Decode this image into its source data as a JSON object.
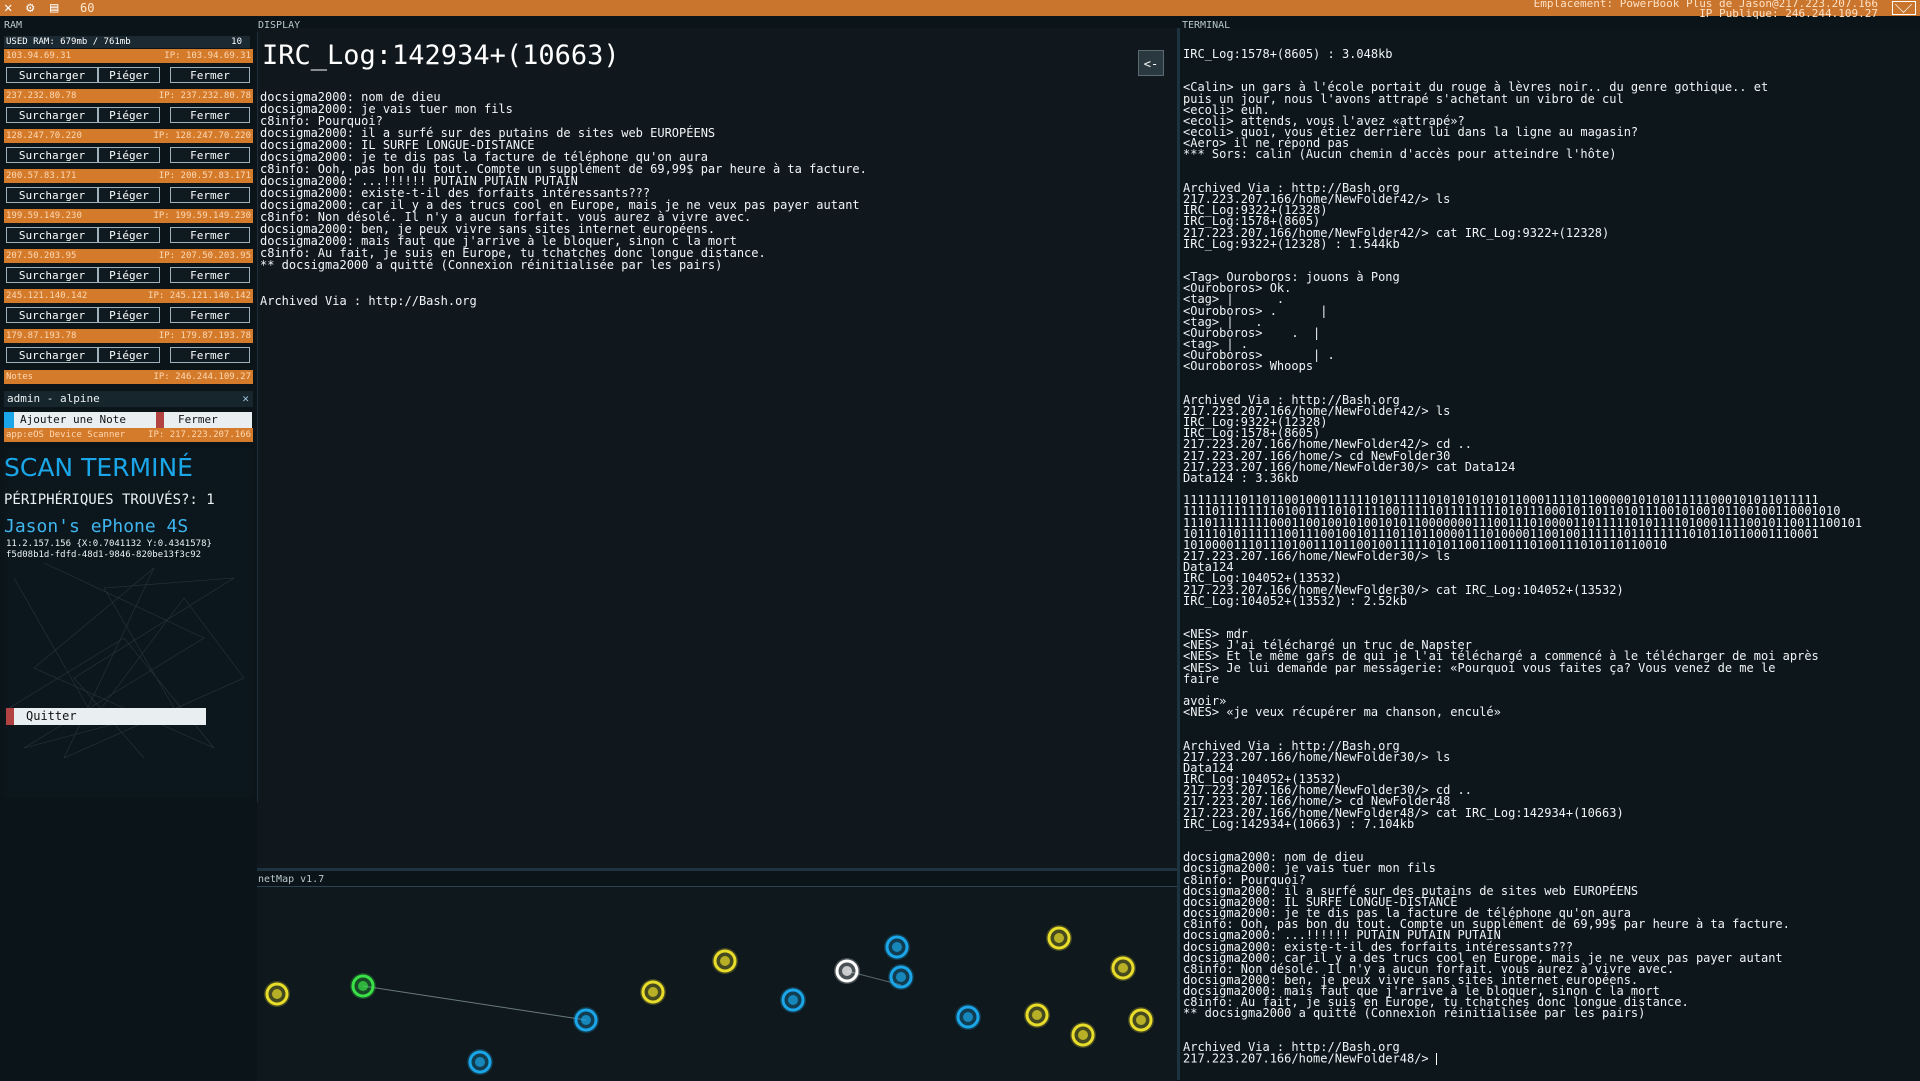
{
  "topbar": {
    "ram_value": "60",
    "location_line1": "Emplacement: PowerBook Plus de Jason@217.223.207.166",
    "location_line2": "IP Publique: 246.244.109.27"
  },
  "labels": {
    "ram": "RAM",
    "display": "DISPLAY",
    "terminal": "TERMINAL",
    "netmap": "netMap v1.7"
  },
  "ram_panel": {
    "used_label": "USED RAM: 679mb / 761mb",
    "used_count": "10",
    "items": [
      {
        "ip": "103.94.69.31",
        "ip_label": "IP: 103.94.69.31"
      },
      {
        "ip": "237.232.80.78",
        "ip_label": "IP: 237.232.80.78"
      },
      {
        "ip": "128.247.70.220",
        "ip_label": "IP: 128.247.70.220"
      },
      {
        "ip": "200.57.83.171",
        "ip_label": "IP: 200.57.83.171"
      },
      {
        "ip": "199.59.149.230",
        "ip_label": "IP: 199.59.149.230"
      },
      {
        "ip": "207.50.203.95",
        "ip_label": "IP: 207.50.203.95"
      },
      {
        "ip": "245.121.140.142",
        "ip_label": "IP: 245.121.140.142"
      },
      {
        "ip": "179.87.193.78",
        "ip_label": "IP: 179.87.193.78"
      }
    ],
    "btn_overload": "Surcharger",
    "btn_trap": "Piéger",
    "btn_close": "Fermer",
    "notes_label": "Notes",
    "notes_ip": "IP: 246.244.109.27",
    "admin_label": "admin - alpine",
    "add_note": "Ajouter une Note",
    "close_note": "Fermer",
    "app_label": "app:eOS Device Scanner",
    "app_ip": "IP: 217.223.207.166"
  },
  "scanner": {
    "title": "SCAN TERMINÉ",
    "found": "PÉRIPHÉRIQUES TROUVÉS?: 1",
    "device": "Jason's ePhone 4S",
    "coords": "11.2.157.156 {X:0.7041132 Y:0.4341578}",
    "uuid": "f5d08b1d-fdfd-48d1-9846-820be13f3c92",
    "quit": "Quitter"
  },
  "display": {
    "title": "IRC_Log:142934+(10663)",
    "back": "<-",
    "body": "docsigma2000: nom de dieu\ndocsigma2000: je vais tuer mon fils\nc8info: Pourquoi?\ndocsigma2000: il a surfé sur des putains de sites web EUROPÉENS\ndocsigma2000: IL SURFE LONGUE-DISTANCE\ndocsigma2000: je te dis pas la facture de téléphone qu'on aura\nc8info: Ooh, pas bon du tout. Compte un supplément de 69,99$ par heure à ta facture.\ndocsigma2000: ...!!!!!! PUTAIN PUTAIN PUTAIN\ndocsigma2000: existe-t-il des forfaits intéressants???\ndocsigma2000: car il y a des trucs cool en Europe, mais je ne veux pas payer autant\nc8info: Non désolé. Il n'y a aucun forfait. vous aurez à vivre avec.\ndocsigma2000: ben, je peux vivre sans sites internet européens.\ndocsigma2000: mais faut que j'arrive à le bloquer, sinon c la mort\nc8info: Au fait, je suis en Europe, tu tchatches donc longue distance.\n** docsigma2000 a quitté (Connexion réinitialisée par les pairs)\n\n\nArchived Via : http://Bash.org"
  },
  "terminal": {
    "body": "IRC_Log:1578+(8605) : 3.048kb\n\n\n<Calin> un gars à l'école portait du rouge à lèvres noir.. du genre gothique.. et\npuis un jour, nous l'avons attrapé s'achetant un vibro de cul\n<ecoli> euh.\n<ecoli> attends, vous l'avez «attrapé»?\n<ecoli> quoi, vous étiez derrière lui dans la ligne au magasin?\n<Aero> il ne répond pas\n*** Sors: calin (Aucun chemin d'accès pour atteindre l'hôte)\n\n\nArchived Via : http://Bash.org\n217.223.207.166/home/NewFolder42/> ls\nIRC_Log:9322+(12328)\nIRC_Log:1578+(8605)\n217.223.207.166/home/NewFolder42/> cat IRC_Log:9322+(12328)\nIRC_Log:9322+(12328) : 1.544kb\n\n\n<Tag> Ouroboros: jouons à Pong\n<Ouroboros> Ok.\n<tag> |      .\n<Ouroboros> .      |\n<tag> |   .\n<Ouroboros>    .  |\n<tag> | .\n<Ouroboros>       | .\n<Ouroboros> Whoops\n\n\nArchived Via : http://Bash.org\n217.223.207.166/home/NewFolder42/> ls\nIRC_Log:9322+(12328)\nIRC_Log:1578+(8605)\n217.223.207.166/home/NewFolder42/> cd ..\n217.223.207.166/home/> cd NewFolder30\n217.223.207.166/home/NewFolder30/> cat Data124\nData124 : 3.36kb\n\n1111111101101100100011111101011111010101010101100011110110000010101011111000101011011111\n1111011111111010011110101111001111101111111101011100010110110101110010100101100100110001010\n1110111111110001100100101001010110000000111001110100001101111101011110100011110010110011100101\n1011101011111100111001001011101101100001110100001100100111111011111111010110110001110001\n1010000111011101001110110010011111010110011001110100111010110110010\n217.223.207.166/home/NewFolder30/> ls\nData124\nIRC_Log:104052+(13532)\n217.223.207.166/home/NewFolder30/> cat IRC_Log:104052+(13532)\nIRC_Log:104052+(13532) : 2.52kb\n\n\n<NES> mdr\n<NES> J'ai téléchargé un truc de Napster\n<NES> Et le même gars de qui je l'ai téléchargé a commencé à le télécharger de moi après\n<NES> Je lui demande par messagerie: «Pourquoi vous faites ça? Vous venez de me le\nfaire\n\navoir»\n<NES> «je veux récupérer ma chanson, enculé»\n\n\nArchived Via : http://Bash.org\n217.223.207.166/home/NewFolder30/> ls\nData124\nIRC_Log:104052+(13532)\n217.223.207.166/home/NewFolder30/> cd ..\n217.223.207.166/home/> cd NewFolder48\n217.223.207.166/home/NewFolder48/> cat IRC_Log:142934+(10663)\nIRC_Log:142934+(10663) : 7.104kb\n\n\ndocsigma2000: nom de dieu\ndocsigma2000: je vais tuer mon fils\nc8info: Pourquoi?\ndocsigma2000: il a surfé sur des putains de sites web EUROPÉENS\ndocsigma2000: IL SURFE LONGUE-DISTANCE\ndocsigma2000: je te dis pas la facture de téléphone qu'on aura\nc8info: Ooh, pas bon du tout. Compte un supplément de 69,99$ par heure à ta facture.\ndocsigma2000: ...!!!!!! PUTAIN PUTAIN PUTAIN\ndocsigma2000: existe-t-il des forfaits intéressants???\ndocsigma2000: car il y a des trucs cool en Europe, mais je ne veux pas payer autant\nc8info: Non désolé. Il n'y a aucun forfait. vous aurez à vivre avec.\ndocsigma2000: ben, je peux vivre sans sites internet européens.\ndocsigma2000: mais faut que j'arrive à le bloquer, sinon c la mort\nc8info: Au fait, je suis en Europe, tu tchatches donc longue distance.\n** docsigma2000 a quitté (Connexion réinitialisée par les pairs)\n\n\nArchived Via : http://Bash.org\n",
    "prompt": "217.223.207.166/home/NewFolder48/> "
  },
  "colors": {
    "accent_orange": "#d47a2b",
    "node_yellow": "#e8dd2a",
    "node_blue": "#1aa6e8",
    "node_green": "#39e046",
    "node_white": "#ffffff"
  }
}
